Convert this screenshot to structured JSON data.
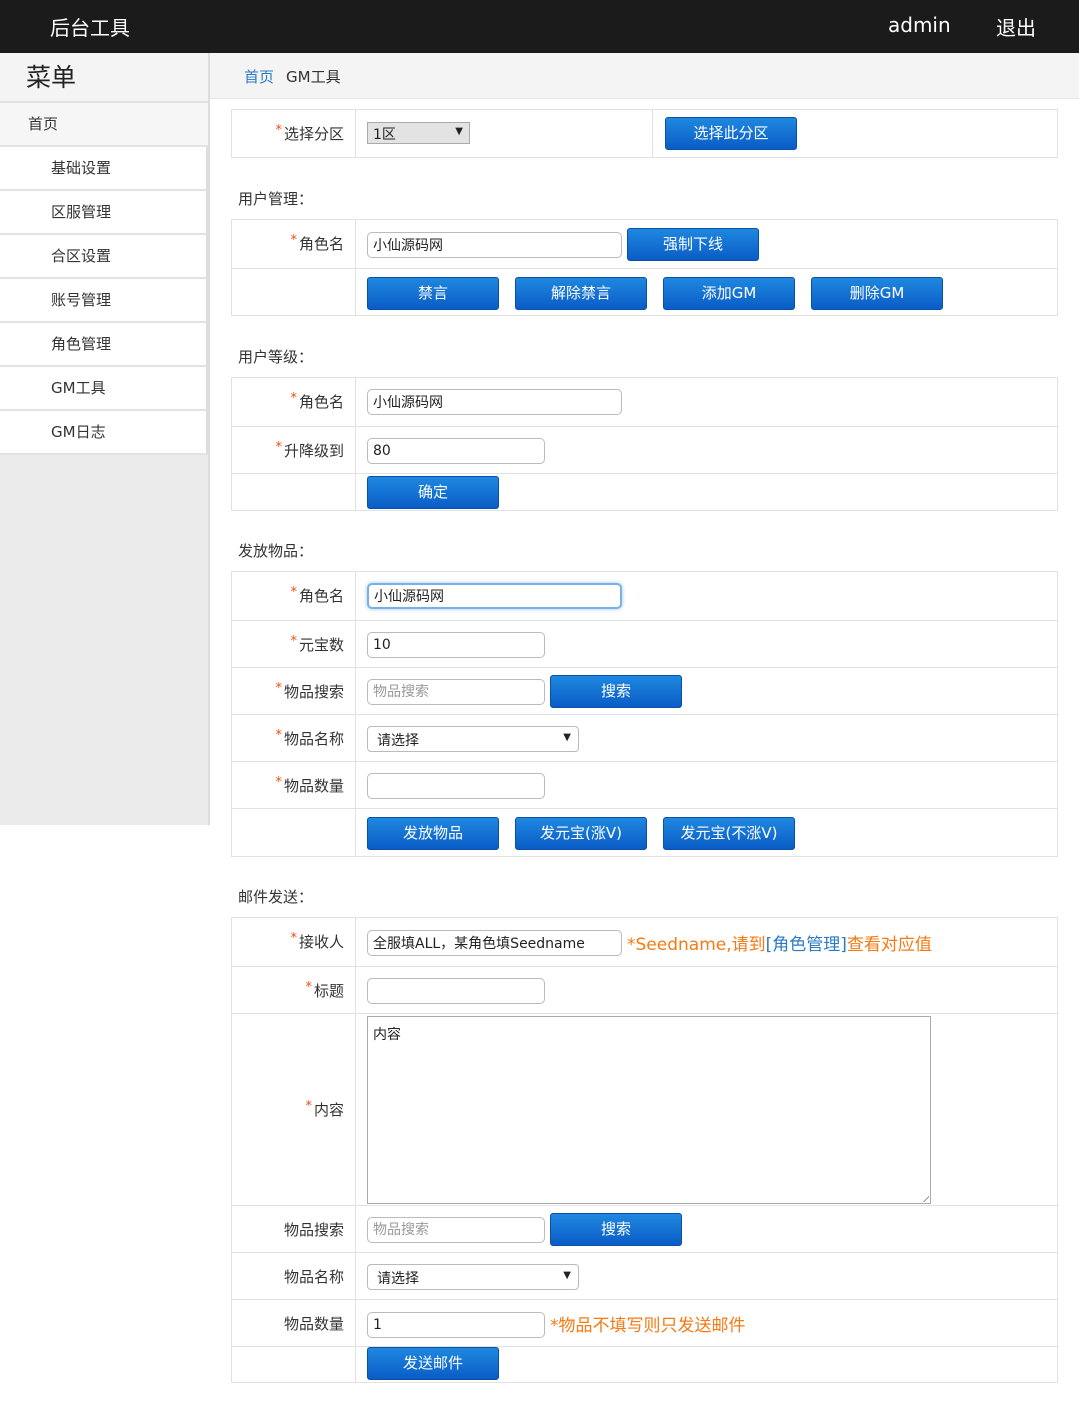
{
  "topbar": {
    "brand": "后台工具",
    "user": "admin",
    "logout": "退出"
  },
  "sidebar": {
    "title": "菜单",
    "home": "首页",
    "items": [
      "基础设置",
      "区服管理",
      "合区设置",
      "账号管理",
      "角色管理",
      "GM工具",
      "GM日志"
    ]
  },
  "breadcrumb": {
    "home": "首页",
    "current": "GM工具"
  },
  "zone": {
    "label": "选择分区",
    "value": "1区",
    "button": "选择此分区"
  },
  "user_mgmt": {
    "section": "用户管理：",
    "role_label": "角色名",
    "role_value": "小仙源码网",
    "force_offline": "强制下线",
    "mute": "禁言",
    "unmute": "解除禁言",
    "add_gm": "添加GM",
    "del_gm": "删除GM"
  },
  "user_level": {
    "section": "用户等级：",
    "role_label": "角色名",
    "role_value": "小仙源码网",
    "level_label": "升降级到",
    "level_value": "80",
    "confirm": "确定"
  },
  "give_items": {
    "section": "发放物品：",
    "role_label": "角色名",
    "role_value": "小仙源码网",
    "gold_label": "元宝数",
    "gold_value": "10",
    "search_label": "物品搜索",
    "search_placeholder": "物品搜索",
    "search_button": "搜索",
    "name_label": "物品名称",
    "name_value": "请选择",
    "qty_label": "物品数量",
    "qty_value": "",
    "give_button": "发放物品",
    "gold_vip_button": "发元宝(涨V)",
    "gold_novip_button": "发元宝(不涨V)"
  },
  "mail": {
    "section": "邮件发送：",
    "recipient_label": "接收人",
    "recipient_value": "全服填ALL，某角色填Seedname",
    "recipient_note_a": "*Seedname,请到",
    "recipient_note_link": "[角色管理]",
    "recipient_note_b": "查看对应值",
    "title_label": "标题",
    "title_value": "",
    "content_label": "内容",
    "content_value": "内容",
    "search_label": "物品搜索",
    "search_placeholder": "物品搜索",
    "search_button": "搜索",
    "name_label": "物品名称",
    "name_value": "请选择",
    "qty_label": "物品数量",
    "qty_value": "1",
    "qty_note": "*物品不填写则只发送邮件",
    "send_button": "发送邮件"
  },
  "colors": {
    "topbar": "#1b1b1b",
    "button": "#0a5cc6",
    "star": "#f04e0c",
    "note": "#f57a13",
    "link": "#2a7bc6"
  }
}
